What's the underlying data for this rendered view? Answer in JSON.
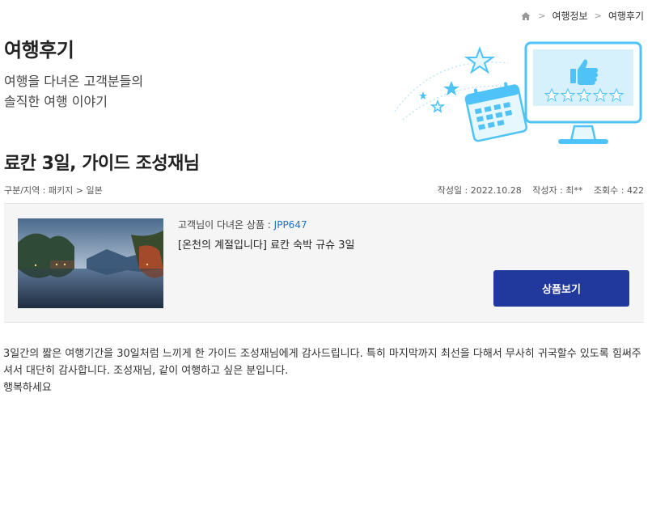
{
  "breadcrumb": {
    "items": [
      "여행정보",
      "여행후기"
    ]
  },
  "header": {
    "title": "여행후기",
    "desc_line1": "여행을 다녀온 고객분들의",
    "desc_line2": "솔직한 여행 이야기"
  },
  "post": {
    "title": "료칸 3일, 가이드 조성재님",
    "category": "구분/지역 : 패키지 > 일본",
    "date": "작성일 : 2022.10.28",
    "author": "작성자 : 최**",
    "views": "조회수 : 422"
  },
  "product": {
    "label": "고객님이 다녀온 상품 : ",
    "code": "JPP647",
    "name": "[온천의 계절입니다] 료칸 숙박 규슈 3일",
    "button_label": "상품보기",
    "button_color": "#21389c"
  },
  "review": {
    "line1": " 3일간의 짧은 여행기간을 30일처럼 느끼게 한 가이드 조성재님에게 감사드립니다.  특히 마지막까지  최선을 다해서 무사히 귀국할수 있도록  힘써주셔서  대단히 감사합니다.  조성재님,  같이 여행하고 싶은 분입니다.",
    "line2": "행복하세요"
  },
  "icons": {
    "home": "home-icon",
    "chevron": "chevron-right-icon"
  },
  "colors": {
    "accent": "#21389c",
    "link": "#1a73c8",
    "illustration": "#4fc3f7"
  }
}
